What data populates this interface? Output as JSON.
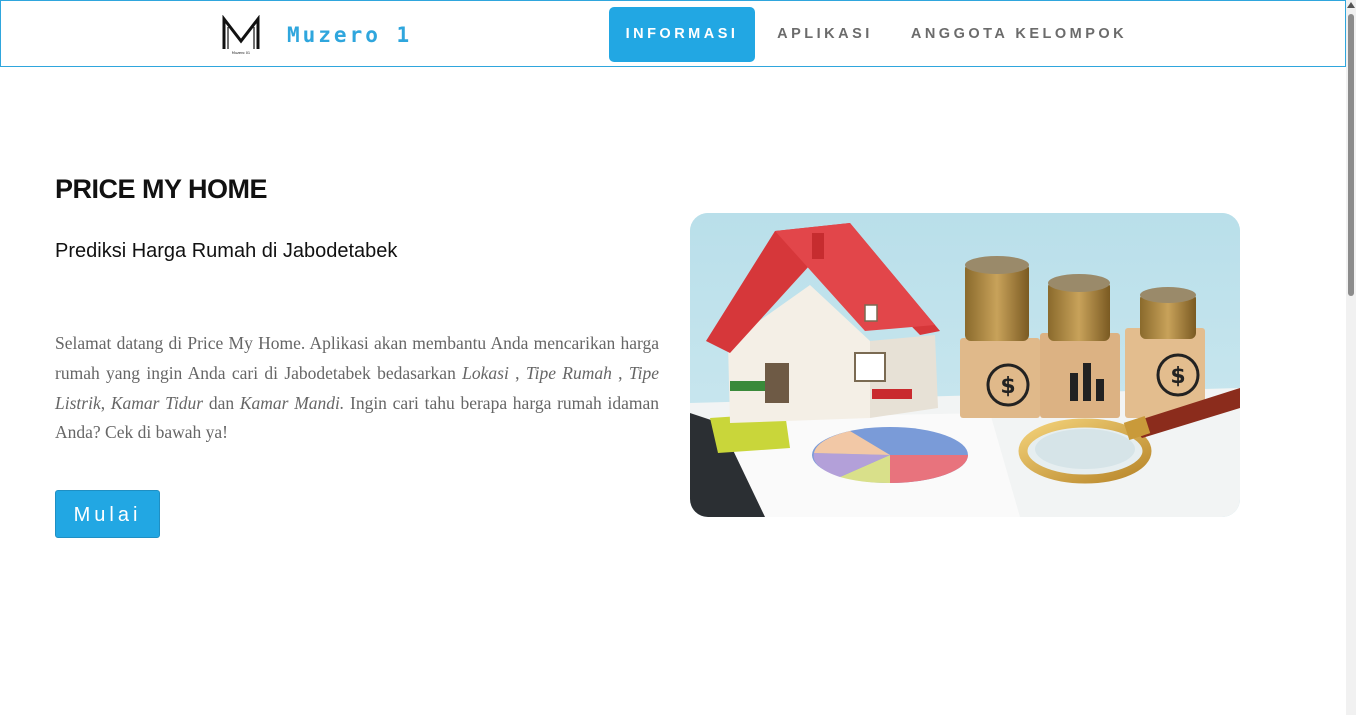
{
  "brand": {
    "name": "Muzero 1",
    "logo_caption": "Muzero 01"
  },
  "nav": {
    "items": [
      {
        "label": "INFORMASI",
        "active": true
      },
      {
        "label": "APLIKASI",
        "active": false
      },
      {
        "label": "ANGGOTA KELOMPOK",
        "active": false
      }
    ]
  },
  "hero": {
    "title": "PRICE MY HOME",
    "subtitle": "Prediksi Harga Rumah di Jabodetabek",
    "description": {
      "intro": "Selamat datang di Price My Home. Aplikasi akan membantu Anda mencarikan harga rumah yang ingin Anda cari di Jabodetabek bedasarkan ",
      "f1": "Lokasi",
      "sep1": " , ",
      "f2": "Tipe Rumah",
      "sep2": " , ",
      "f3": "Tipe Listrik",
      "sep3": ", ",
      "f4": "Kamar Tidur",
      "sep4": " dan ",
      "f5": "Kamar Mandi.",
      "outro": " Ingin cari tahu berapa harga rumah idaman Anda? Cek di bawah ya!"
    },
    "button_label": "Mulai"
  },
  "colors": {
    "accent": "#22a7e3",
    "brand_text": "#2fa6dd",
    "nav_text": "#6b6b6b"
  },
  "icons": [
    "logo-m-icon",
    "scroll-up-icon"
  ]
}
